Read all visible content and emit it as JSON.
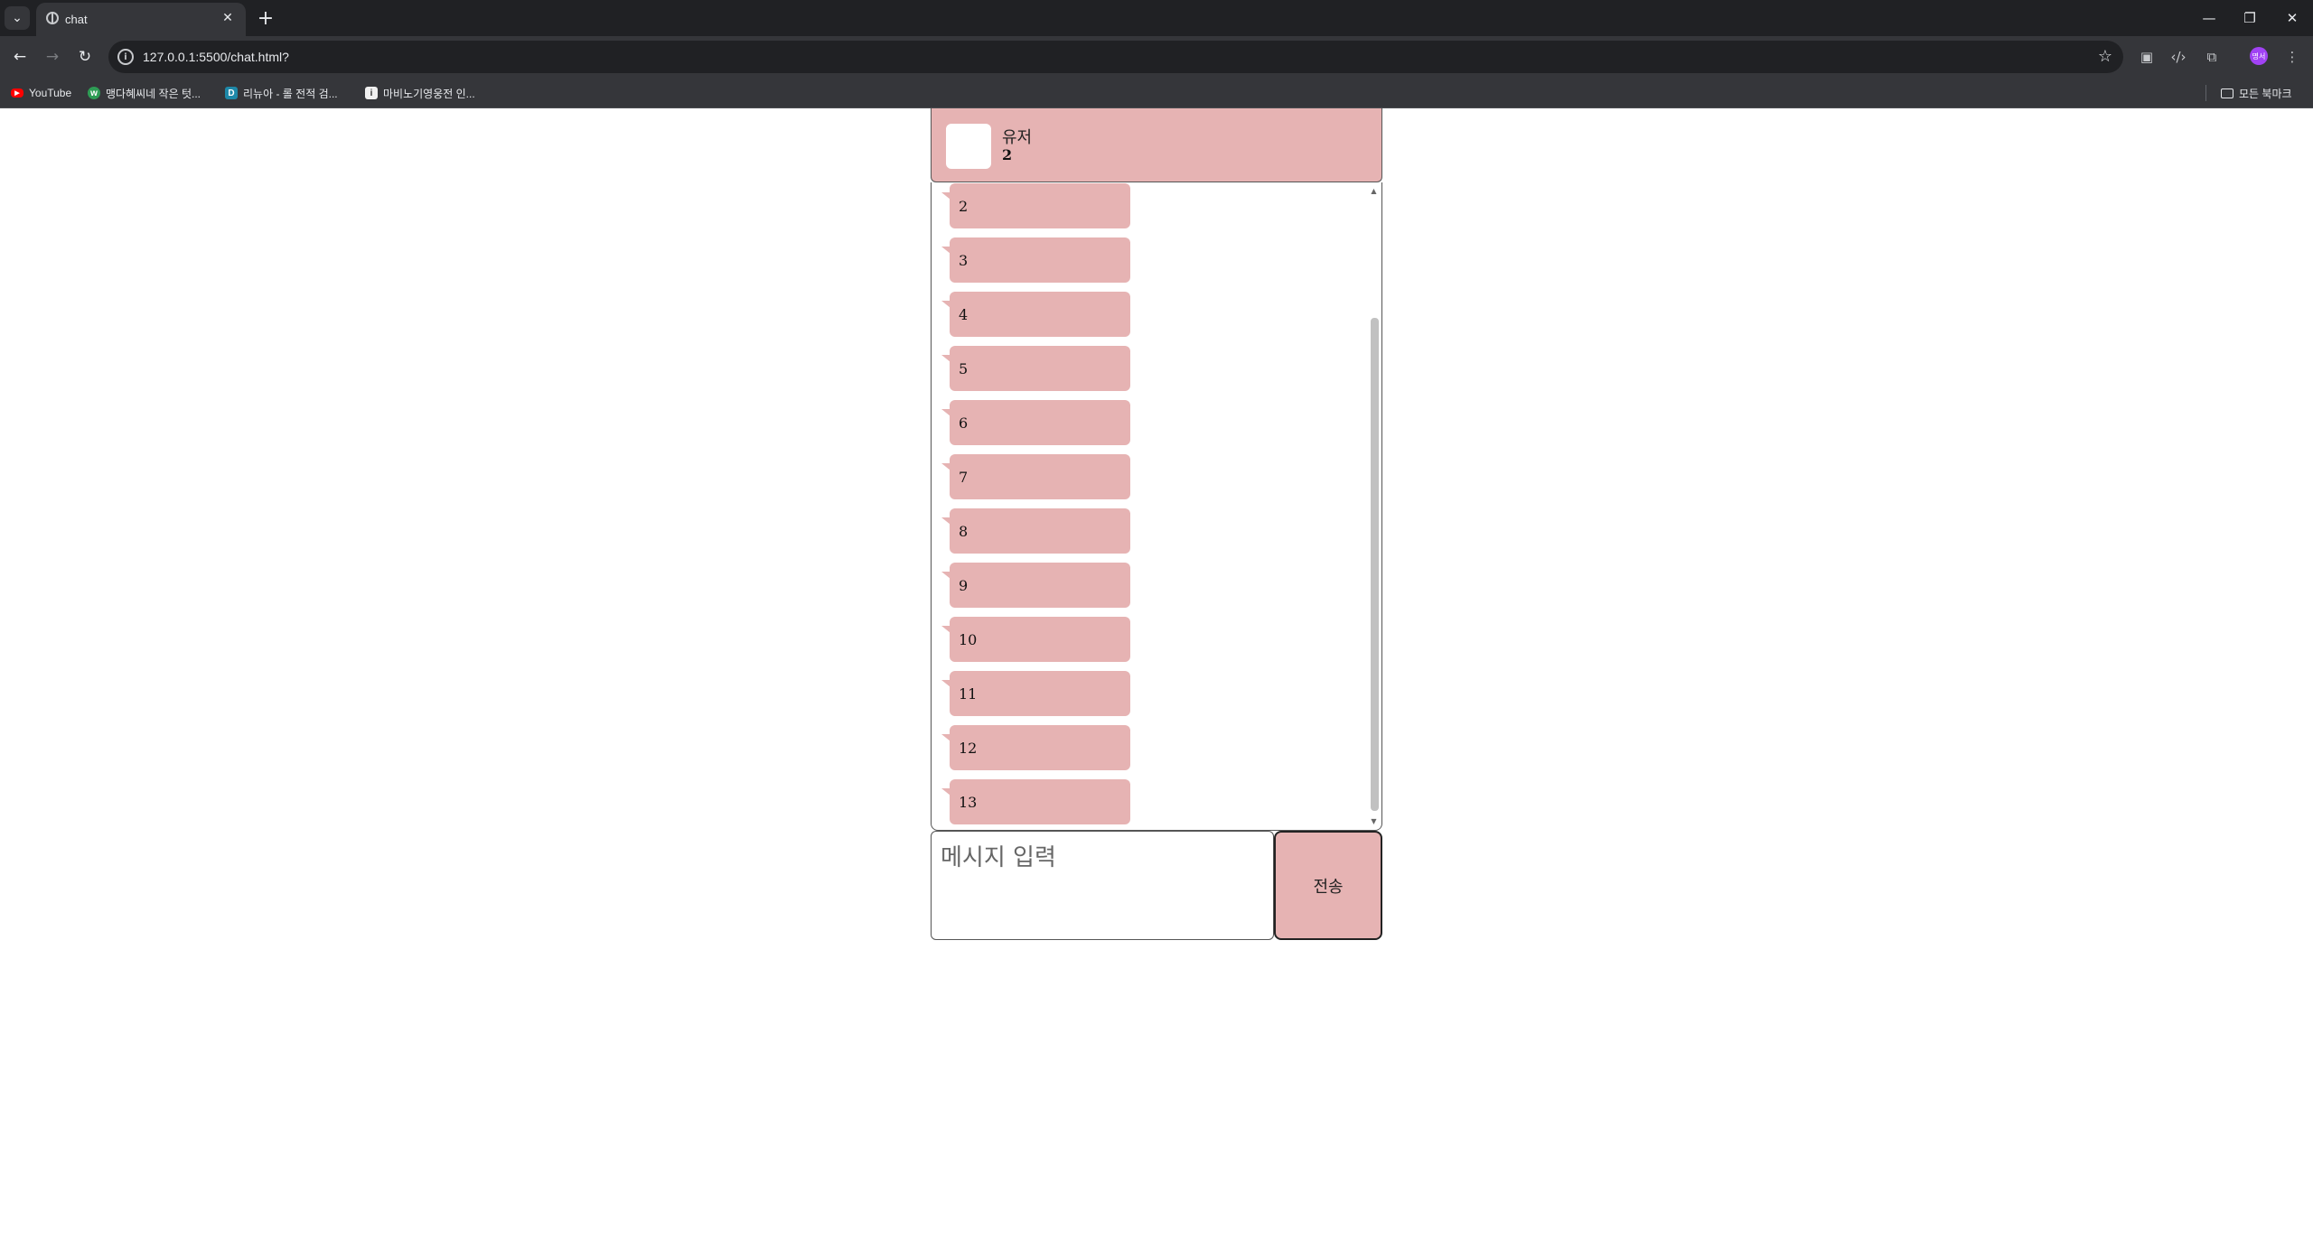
{
  "browser": {
    "tab_title": "chat",
    "new_tab_icon": "+",
    "url": "127.0.0.1:5500/chat.html?",
    "bookmarks": [
      {
        "label": "YouTube",
        "icon": "youtube-icon"
      },
      {
        "label": "맹다혜씨네 작은 텃...",
        "icon": "green-circle-icon"
      },
      {
        "label": "리뉴아 - 롤 전적 검...",
        "icon": "d-icon"
      },
      {
        "label": "마비노기영웅전 인...",
        "icon": "w-icon"
      }
    ],
    "all_bookmarks_label": "모든 북마크",
    "profile_initials": "명서"
  },
  "chat": {
    "header": {
      "name": "유저",
      "sub": "2"
    },
    "messages": [
      {
        "text": "2"
      },
      {
        "text": "3"
      },
      {
        "text": "4"
      },
      {
        "text": "5"
      },
      {
        "text": "6"
      },
      {
        "text": "7"
      },
      {
        "text": "8"
      },
      {
        "text": "9"
      },
      {
        "text": "10"
      },
      {
        "text": "11"
      },
      {
        "text": "12"
      },
      {
        "text": "13"
      }
    ],
    "input": {
      "placeholder": "메시지 입력",
      "value": ""
    },
    "send_label": "전송",
    "accent_color": "#e6b3b3"
  }
}
